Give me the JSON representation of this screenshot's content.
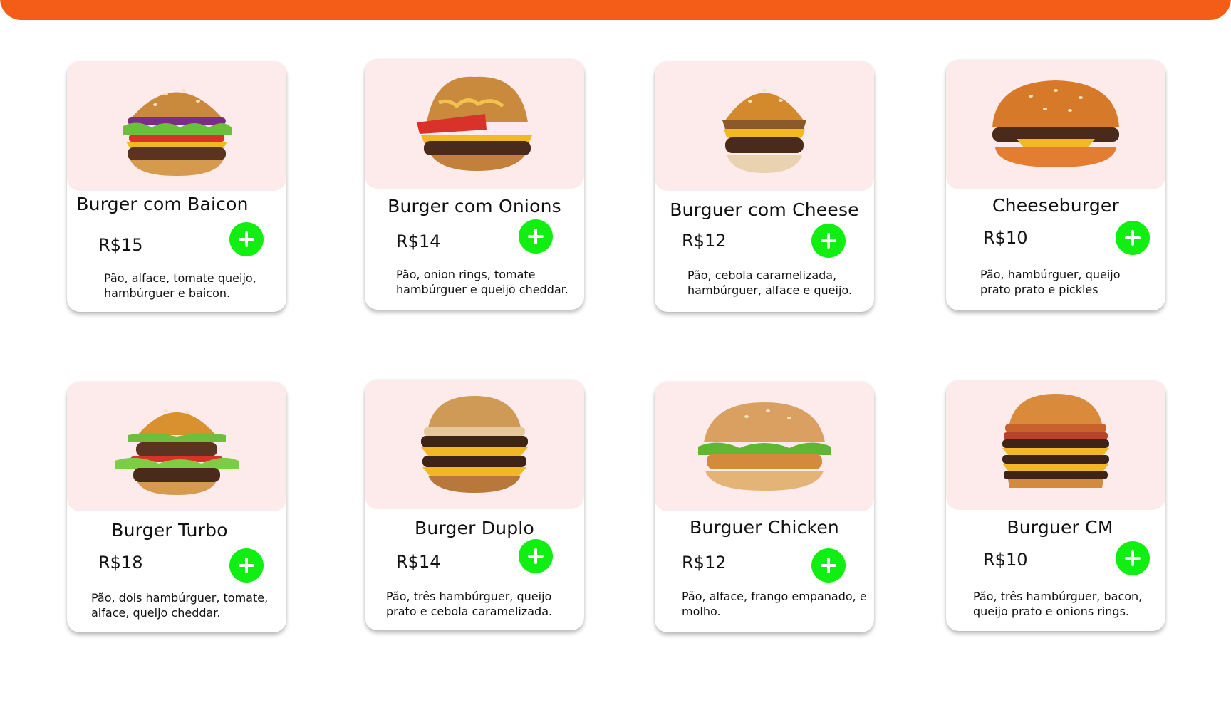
{
  "colors": {
    "top_bar": "#f45d17",
    "image_bg": "#fdeaea",
    "add_button": "#11ee11"
  },
  "products": [
    {
      "name": "Burger com Baicon",
      "price": "R$15",
      "description": "Pão, alface, tomate queijo, hambúrguer e baicon.",
      "add_icon": "plus-icon"
    },
    {
      "name": "Burger com Onions",
      "price": "R$14",
      "description": "Pão, onion rings, tomate hambúrguer e queijo cheddar.",
      "add_icon": "plus-icon"
    },
    {
      "name": "Burguer com Cheese",
      "price": "R$12",
      "description": "Pão, cebola caramelizada, hambúrguer, alface e queijo.",
      "add_icon": "plus-icon"
    },
    {
      "name": "Cheeseburger",
      "price": "R$10",
      "description": "Pão, hambúrguer, queijo prato prato e pickles",
      "add_icon": "plus-icon"
    },
    {
      "name": "Burger Turbo",
      "price": "R$18",
      "description": "Pão, dois hambúrguer, tomate, alface, queijo cheddar.",
      "add_icon": "plus-icon"
    },
    {
      "name": "Burger Duplo",
      "price": "R$14",
      "description": "Pão, três hambúrguer, queijo prato e cebola caramelizada.",
      "add_icon": "plus-icon"
    },
    {
      "name": "Burguer Chicken",
      "price": "R$12",
      "description": "Pão, alface, frango empanado, e molho.",
      "add_icon": "plus-icon"
    },
    {
      "name": "Burguer CM",
      "price": "R$10",
      "description": "Pão, três hambúrguer, bacon, queijo prato e onions rings.",
      "add_icon": "plus-icon"
    }
  ]
}
